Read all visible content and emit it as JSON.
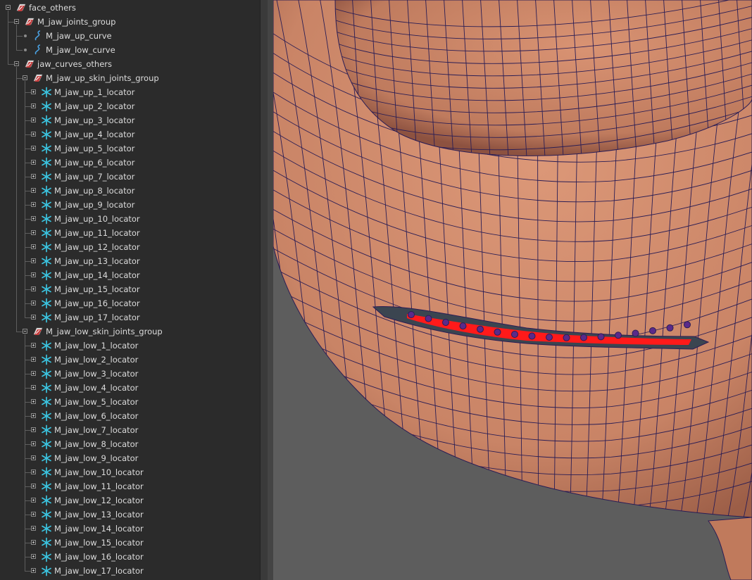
{
  "outliner": {
    "rows": [
      {
        "label": "face_others",
        "type": "group",
        "depth": 0,
        "expander": "minus"
      },
      {
        "label": "M_jaw_joints_group",
        "type": "group",
        "depth": 1,
        "expander": "minus"
      },
      {
        "label": "M_jaw_up_curve",
        "type": "curve",
        "depth": 2,
        "expander": "dot"
      },
      {
        "label": "M_jaw_low_curve",
        "type": "curve",
        "depth": 2,
        "expander": "dot"
      },
      {
        "label": "jaw_curves_others",
        "type": "group",
        "depth": 1,
        "expander": "minus"
      },
      {
        "label": "M_jaw_up_skin_joints_group",
        "type": "group",
        "depth": 2,
        "expander": "minus"
      },
      {
        "label": "M_jaw_up_1_locator",
        "type": "locator",
        "depth": 3,
        "expander": "plus"
      },
      {
        "label": "M_jaw_up_2_locator",
        "type": "locator",
        "depth": 3,
        "expander": "plus"
      },
      {
        "label": "M_jaw_up_3_locator",
        "type": "locator",
        "depth": 3,
        "expander": "plus"
      },
      {
        "label": "M_jaw_up_4_locator",
        "type": "locator",
        "depth": 3,
        "expander": "plus"
      },
      {
        "label": "M_jaw_up_5_locator",
        "type": "locator",
        "depth": 3,
        "expander": "plus"
      },
      {
        "label": "M_jaw_up_6_locator",
        "type": "locator",
        "depth": 3,
        "expander": "plus"
      },
      {
        "label": "M_jaw_up_7_locator",
        "type": "locator",
        "depth": 3,
        "expander": "plus"
      },
      {
        "label": "M_jaw_up_8_locator",
        "type": "locator",
        "depth": 3,
        "expander": "plus"
      },
      {
        "label": "M_jaw_up_9_locator",
        "type": "locator",
        "depth": 3,
        "expander": "plus"
      },
      {
        "label": "M_jaw_up_10_locator",
        "type": "locator",
        "depth": 3,
        "expander": "plus"
      },
      {
        "label": "M_jaw_up_11_locator",
        "type": "locator",
        "depth": 3,
        "expander": "plus"
      },
      {
        "label": "M_jaw_up_12_locator",
        "type": "locator",
        "depth": 3,
        "expander": "plus"
      },
      {
        "label": "M_jaw_up_13_locator",
        "type": "locator",
        "depth": 3,
        "expander": "plus"
      },
      {
        "label": "M_jaw_up_14_locator",
        "type": "locator",
        "depth": 3,
        "expander": "plus"
      },
      {
        "label": "M_jaw_up_15_locator",
        "type": "locator",
        "depth": 3,
        "expander": "plus"
      },
      {
        "label": "M_jaw_up_16_locator",
        "type": "locator",
        "depth": 3,
        "expander": "plus"
      },
      {
        "label": "M_jaw_up_17_locator",
        "type": "locator",
        "depth": 3,
        "expander": "plus"
      },
      {
        "label": "M_jaw_low_skin_joints_group",
        "type": "group",
        "depth": 2,
        "expander": "minus"
      },
      {
        "label": "M_jaw_low_1_locator",
        "type": "locator",
        "depth": 3,
        "expander": "plus"
      },
      {
        "label": "M_jaw_low_2_locator",
        "type": "locator",
        "depth": 3,
        "expander": "plus"
      },
      {
        "label": "M_jaw_low_3_locator",
        "type": "locator",
        "depth": 3,
        "expander": "plus"
      },
      {
        "label": "M_jaw_low_4_locator",
        "type": "locator",
        "depth": 3,
        "expander": "plus"
      },
      {
        "label": "M_jaw_low_5_locator",
        "type": "locator",
        "depth": 3,
        "expander": "plus"
      },
      {
        "label": "M_jaw_low_6_locator",
        "type": "locator",
        "depth": 3,
        "expander": "plus"
      },
      {
        "label": "M_jaw_low_7_locator",
        "type": "locator",
        "depth": 3,
        "expander": "plus"
      },
      {
        "label": "M_jaw_low_8_locator",
        "type": "locator",
        "depth": 3,
        "expander": "plus"
      },
      {
        "label": "M_jaw_low_9_locator",
        "type": "locator",
        "depth": 3,
        "expander": "plus"
      },
      {
        "label": "M_jaw_low_10_locator",
        "type": "locator",
        "depth": 3,
        "expander": "plus"
      },
      {
        "label": "M_jaw_low_11_locator",
        "type": "locator",
        "depth": 3,
        "expander": "plus"
      },
      {
        "label": "M_jaw_low_12_locator",
        "type": "locator",
        "depth": 3,
        "expander": "plus"
      },
      {
        "label": "M_jaw_low_13_locator",
        "type": "locator",
        "depth": 3,
        "expander": "plus"
      },
      {
        "label": "M_jaw_low_14_locator",
        "type": "locator",
        "depth": 3,
        "expander": "plus"
      },
      {
        "label": "M_jaw_low_15_locator",
        "type": "locator",
        "depth": 3,
        "expander": "plus"
      },
      {
        "label": "M_jaw_low_16_locator",
        "type": "locator",
        "depth": 3,
        "expander": "plus"
      },
      {
        "label": "M_jaw_low_17_locator",
        "type": "locator",
        "depth": 3,
        "expander": "plus"
      }
    ],
    "icons": {
      "group": "transform-group-icon",
      "curve": "nurbs-curve-icon",
      "locator": "locator-icon"
    }
  },
  "viewport": {
    "background_color": "#5d5d5d",
    "skin_color": "#cf8a6b",
    "wire_color": "#2a1d55",
    "lip_highlight_color": "#ff1a1a",
    "selected_vertex_color": "#5a2a8a",
    "selected_vertex_count": 17
  }
}
